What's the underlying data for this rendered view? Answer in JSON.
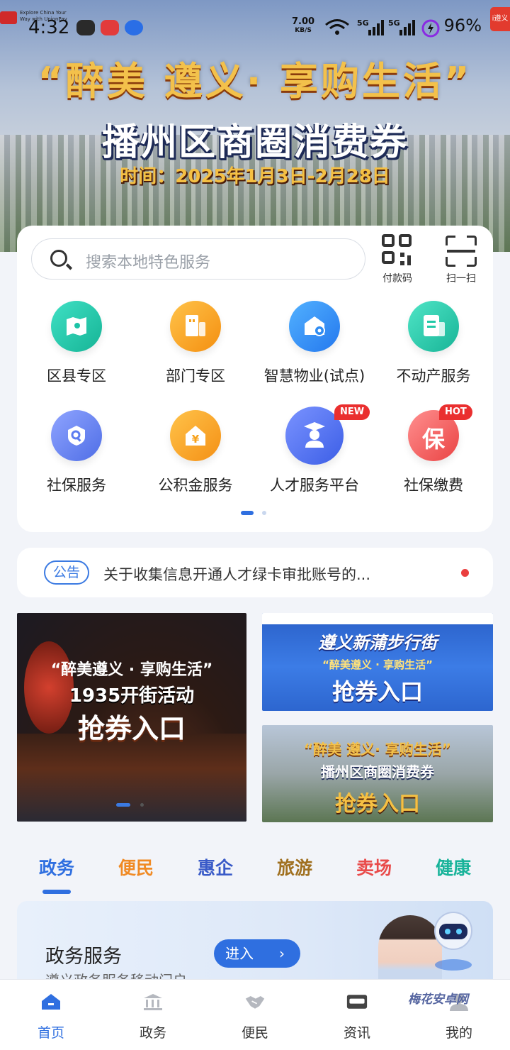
{
  "status_bar": {
    "time": "4:32",
    "net_speed_value": "7.00",
    "net_speed_unit": "KB/S",
    "signal_1": "5G",
    "signal_2": "5G",
    "battery": "96%",
    "unionpay_tagline": "Explore China Your Way with UnionPay",
    "badge_text": "i遵义"
  },
  "hero": {
    "slogan": "“醉美 遵义· 享购生活”",
    "title": "播州区商圈消费券",
    "period": "时间：2025年1月3日-2月28日"
  },
  "search": {
    "placeholder": "搜索本地特色服务"
  },
  "quick_actions": [
    {
      "label": "付款码",
      "icon": "qr-code-icon"
    },
    {
      "label": "扫一扫",
      "icon": "scan-icon"
    }
  ],
  "services": [
    {
      "label": "区县专区",
      "icon": "map-icon",
      "color": "#1cc3a6",
      "tag": ""
    },
    {
      "label": "部门专区",
      "icon": "building-icon",
      "color": "#f7a21b",
      "tag": ""
    },
    {
      "label": "智慧物业(试点)",
      "icon": "smart-property-icon",
      "color": "#2f8cf2",
      "tag": ""
    },
    {
      "label": "不动产服务",
      "icon": "real-estate-icon",
      "color": "#22c9a7",
      "tag": ""
    },
    {
      "label": "社保服务",
      "icon": "social-security-icon",
      "color": "#5c7cf0",
      "tag": ""
    },
    {
      "label": "公积金服务",
      "icon": "housing-fund-icon",
      "color": "#f7a21b",
      "tag": ""
    },
    {
      "label": "人才服务平台",
      "icon": "talent-icon",
      "color": "#4d6ff0",
      "tag": "NEW"
    },
    {
      "label": "社保缴费",
      "icon": "insurance-payment-icon",
      "color": "#f25c5c",
      "tag": "HOT"
    }
  ],
  "notice": {
    "label": "公告",
    "text": "关于收集信息开通人才绿卡审批账号的..."
  },
  "banners": {
    "big": {
      "line1": "“醉美遵义 · 享购生活”",
      "line2": "1935开街活动",
      "line3": "抢券入口"
    },
    "a": {
      "line1": "遵义新蒲步行街",
      "line2": "“醉美遵义 · 享购生活”",
      "line3": "抢券入口"
    },
    "b": {
      "line1": "“醉美 遵义· 享购生活”",
      "line2": "播州区商圈消费券",
      "line3": "抢券入口"
    }
  },
  "tabs": [
    {
      "label": "政务",
      "color": "#2f6fe0"
    },
    {
      "label": "便民",
      "color": "#f08a24"
    },
    {
      "label": "惠企",
      "color": "#3a5bc8"
    },
    {
      "label": "旅游",
      "color": "#a07020"
    },
    {
      "label": "卖场",
      "color": "#e94b4b"
    },
    {
      "label": "健康",
      "color": "#18b39a"
    }
  ],
  "service_panel": {
    "title": "政务服务",
    "subtitle": "遵义政务服务移动门户",
    "button": "进入"
  },
  "bottom_nav": [
    {
      "label": "首页",
      "icon": "home-icon",
      "active": true
    },
    {
      "label": "政务",
      "icon": "government-icon",
      "active": false
    },
    {
      "label": "便民",
      "icon": "handshake-icon",
      "active": false
    },
    {
      "label": "资讯",
      "icon": "news-icon",
      "active": false
    },
    {
      "label": "我的",
      "icon": "profile-icon",
      "active": false
    }
  ],
  "watermark": "梅花安卓网"
}
